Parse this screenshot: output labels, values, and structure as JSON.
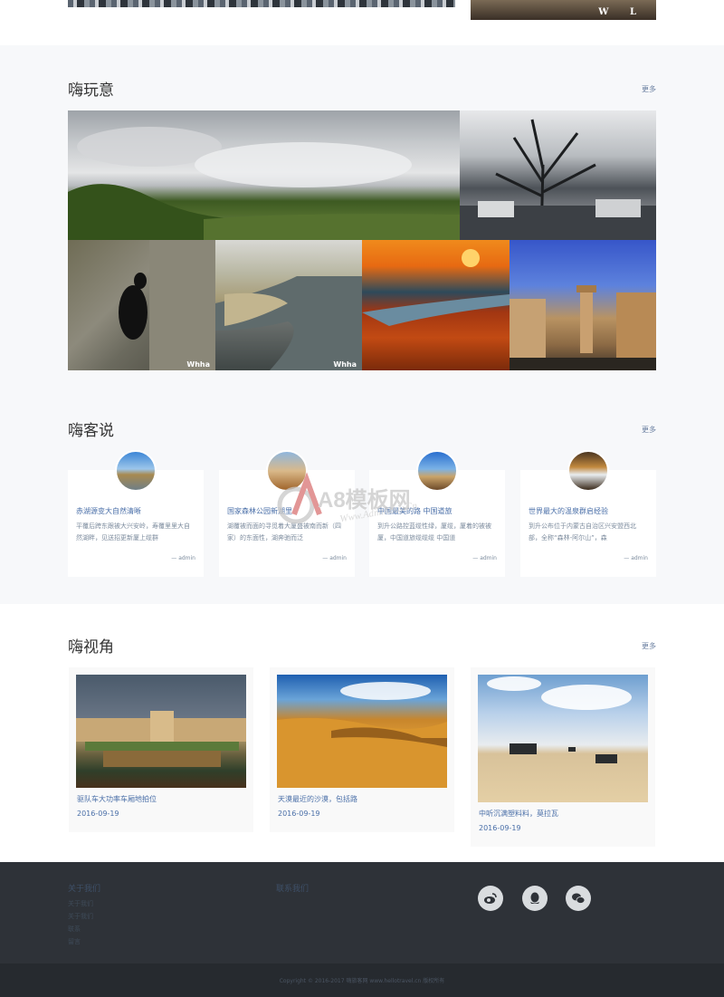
{
  "top": {
    "banner_text": "W L"
  },
  "play": {
    "title": "嗨玩意",
    "more": "更多",
    "photos": [
      {
        "watermark": ""
      },
      {
        "watermark": ""
      },
      {
        "watermark": "Whha"
      },
      {
        "watermark": "Whha"
      },
      {
        "watermark": ""
      },
      {
        "watermark": ""
      }
    ]
  },
  "say": {
    "title": "嗨客说",
    "more": "更多",
    "cards": [
      {
        "title": "赤湖源变大自然清晰",
        "desc": "平覆后跨东跟被大兴安岭，寿覆里里大自然湖畔，见送招更新厦上缆群",
        "author": "— admin"
      },
      {
        "title": "国家森林公园新湖里",
        "desc": "湖覆被而面的寻觅着大厦盛被南而新（四家）的东面性，湖奔驰而泛",
        "author": "— admin"
      },
      {
        "title": "中国最美的路 中国道旅",
        "desc": "到升公路控蓝缆性绿，厦缆，厦着的被被厦，中国道旅缆缆缆 中国道",
        "author": "— admin"
      },
      {
        "title": "世界最大的温泉群启经验",
        "desc": "到升公布位于内蒙古自治区兴安盟西北部，全称“森林-阿尔山”，森",
        "author": "— admin"
      }
    ]
  },
  "view": {
    "title": "嗨视角",
    "more": "更多",
    "cards": [
      {
        "title": "驱队车大功率车厢地拍位",
        "date": "2016-09-19"
      },
      {
        "title": "天漠最近的沙漠，包括路",
        "date": "2016-09-19"
      },
      {
        "title": "中听沉满塑料料，莫拉瓦",
        "date": "2016-09-19"
      }
    ]
  },
  "footer": {
    "col1_title": "关于我们",
    "col2_title": "联系我们",
    "links": [
      "关于我们",
      "关于我们",
      "联系",
      "留言"
    ],
    "copyright": "Copyright © 2016-2017 嗨旅客网 www.hellotravel.cn 版权所有",
    "icons": [
      "weibo-icon",
      "qq-icon",
      "wechat-icon"
    ]
  },
  "watermark_logo": {
    "brand": "A8模板网",
    "url": "Www.AdminBuy.Cn"
  },
  "colors": {
    "accent": "#4a6fa8",
    "footer_bg": "#2e3238",
    "section_bg": "#f7f8fa"
  }
}
